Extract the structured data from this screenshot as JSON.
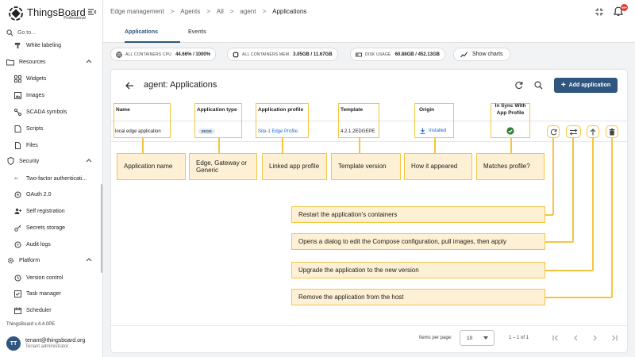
{
  "app": {
    "name": "ThingsBoard",
    "edition": "Professional",
    "version": "ThingsBoard v.4.4.0PE"
  },
  "sidebar": {
    "search_placeholder": "Go to...",
    "items": [
      {
        "label": "White labeling",
        "icon": "format-paint-icon"
      },
      {
        "label": "Resources",
        "icon": "folder-icon",
        "expanded": true
      },
      {
        "label": "Widgets",
        "icon": "widgets-icon"
      },
      {
        "label": "Images",
        "icon": "image-icon"
      },
      {
        "label": "SCADA symbols",
        "icon": "scada-icon"
      },
      {
        "label": "Scripts",
        "icon": "code-icon"
      },
      {
        "label": "Files",
        "icon": "file-icon"
      },
      {
        "label": "Security",
        "icon": "shield-icon",
        "expanded": true
      },
      {
        "label": "Two-factor authenticati...",
        "icon": "two-factor-icon"
      },
      {
        "label": "OAuth 2.0",
        "icon": "oauth-icon"
      },
      {
        "label": "Self registration",
        "icon": "person-add-icon"
      },
      {
        "label": "Secrets storage",
        "icon": "key-icon"
      },
      {
        "label": "Audit logs",
        "icon": "track-changes-icon"
      },
      {
        "label": "Platform",
        "icon": "settings-icon",
        "expanded": true
      },
      {
        "label": "Version control",
        "icon": "history-icon"
      },
      {
        "label": "Task manager",
        "icon": "task-icon"
      },
      {
        "label": "Scheduler",
        "icon": "schedule-icon"
      }
    ],
    "user": {
      "initials": "TT",
      "email": "tenant@thingsboard.org",
      "role": "Tenant administrator"
    }
  },
  "header": {
    "breadcrumbs": [
      "Edge management",
      "Agents",
      "All",
      "agent",
      "Applications"
    ],
    "notifications_badge": "99+"
  },
  "tabs": [
    {
      "label": "Applications",
      "active": true
    },
    {
      "label": "Events",
      "active": false
    }
  ],
  "stats": {
    "cpu_label": "ALL CONTAINERS CPU",
    "cpu_value": "44.66% / 1000%",
    "mem_label": "ALL CONTAINERS MEM",
    "mem_value": "3.05GB / 11.67GB",
    "disk_label": "DISK USAGE",
    "disk_value": "60.88GB / 452.13GB",
    "show_charts": "Show charts"
  },
  "card": {
    "title": "agent: Applications",
    "add_button": "Add application"
  },
  "table": {
    "columns": [
      "Name",
      "Application type",
      "Application profile",
      "Template",
      "Origin",
      "In Sync With App Profile"
    ],
    "row": {
      "name": "local edge application",
      "type": "EDGE",
      "profile": "Site-1 Edge Profile",
      "template": "4.2.1.2EDGEPE",
      "origin": "Installed",
      "in_sync": true
    }
  },
  "column_notes": [
    "Application name",
    "Edge, Gateway or Generic",
    "Linked app profile",
    "Template version",
    "How it appeared",
    "Matches profile?"
  ],
  "action_notes": [
    "Restart the application's containers",
    "Opens a dialog to edit the Compose configuration, pull images, then apply",
    "Upgrade the application to the new version",
    "Remove the application from the host"
  ],
  "pagination": {
    "items_per_page_label": "Items per page:",
    "page_size": "10",
    "range": "1 – 1 of 1"
  },
  "colors": {
    "primary": "#305680",
    "highlight": "#f5c542",
    "note_fill": "#fdf0d5",
    "link": "#1e6ad4",
    "success": "#2e7d32",
    "badge": "#e53935"
  }
}
